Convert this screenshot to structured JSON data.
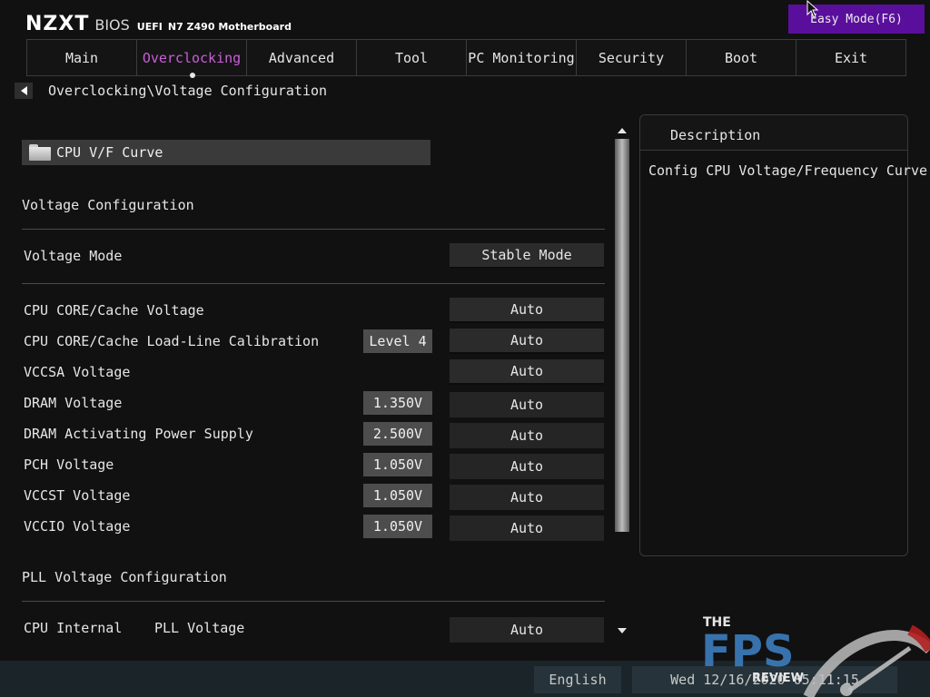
{
  "header": {
    "brand": "NZXT",
    "bios": "BIOS",
    "uefi": "UEFI",
    "model": "N7 Z490 Motherboard",
    "easy_mode": "Easy Mode(F6)"
  },
  "tabs": [
    {
      "label": "Main",
      "active": false
    },
    {
      "label": "Overclocking",
      "active": true
    },
    {
      "label": "Advanced",
      "active": false
    },
    {
      "label": "Tool",
      "active": false
    },
    {
      "label": "PC Monitoring",
      "active": false
    },
    {
      "label": "Security",
      "active": false
    },
    {
      "label": "Boot",
      "active": false
    },
    {
      "label": "Exit",
      "active": false
    }
  ],
  "breadcrumb": "Overclocking\\Voltage Configuration",
  "folder": {
    "label": "CPU V/F Curve"
  },
  "sections": {
    "voltage_config": "Voltage Configuration",
    "pll_config": "PLL Voltage Configuration"
  },
  "voltage_mode": {
    "label": "Voltage Mode",
    "value": "Stable Mode"
  },
  "rows": [
    {
      "label": "CPU CORE/Cache Voltage",
      "current": "",
      "value": "Auto"
    },
    {
      "label": "CPU CORE/Cache Load-Line Calibration",
      "current": "Level 4",
      "value": "Auto"
    },
    {
      "label": "VCCSA Voltage",
      "current": "",
      "value": "Auto"
    },
    {
      "label": "DRAM Voltage",
      "current": "1.350V",
      "value": "Auto"
    },
    {
      "label": "DRAM Activating Power Supply",
      "current": "2.500V",
      "value": "Auto"
    },
    {
      "label": "PCH Voltage",
      "current": "1.050V",
      "value": "Auto"
    },
    {
      "label": "VCCST Voltage",
      "current": "1.050V",
      "value": "Auto"
    },
    {
      "label": "VCCIO Voltage",
      "current": "1.050V",
      "value": "Auto"
    }
  ],
  "pll_row": {
    "label_a": "CPU Internal",
    "label_b": "PLL Voltage",
    "value": "Auto"
  },
  "description": {
    "title": "Description",
    "text": "Config CPU Voltage/Frequency Curve"
  },
  "status": {
    "language": "English",
    "datetime": "Wed 12/16/2020  05:11:15"
  },
  "watermark": {
    "the": "THE",
    "fps": "FPS",
    "review": "REVIEW"
  },
  "colors": {
    "accent": "#c95fd8",
    "easy_mode_bg": "#5a0f9c",
    "statusbar_bg": "#1b2428"
  }
}
